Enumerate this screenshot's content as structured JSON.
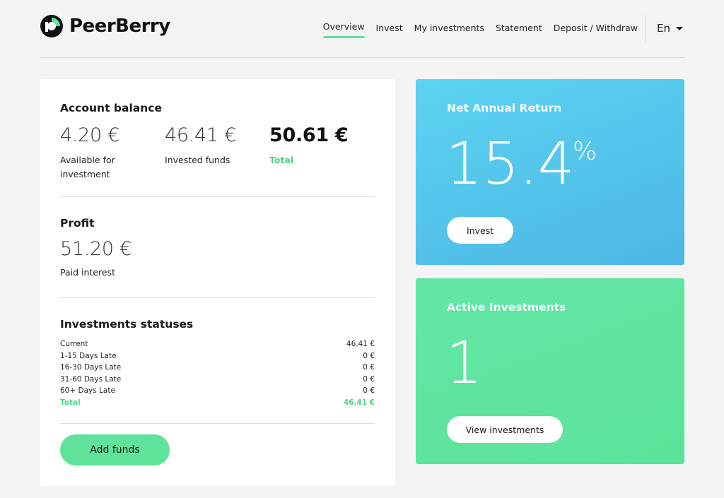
{
  "brand": {
    "name": "PeerBerry"
  },
  "nav": {
    "items": [
      {
        "label": "Overview",
        "active": true
      },
      {
        "label": "Invest",
        "active": false
      },
      {
        "label": "My investments",
        "active": false
      },
      {
        "label": "Statement",
        "active": false
      },
      {
        "label": "Deposit / Withdraw",
        "active": false
      }
    ],
    "language": "En"
  },
  "account_balance": {
    "title": "Account balance",
    "available_amount": "4.20 €",
    "available_label": "Available for investment",
    "invested_amount": "46.41 €",
    "invested_label": "Invested funds",
    "total_amount": "50.61 €",
    "total_label": "Total"
  },
  "profit": {
    "title": "Profit",
    "amount": "51.20 €",
    "label": "Paid interest"
  },
  "statuses": {
    "title": "Investments statuses",
    "rows": [
      {
        "label": "Current",
        "value": "46.41 €"
      },
      {
        "label": "1-15 Days Late",
        "value": "0 €"
      },
      {
        "label": "16-30 Days Late",
        "value": "0 €"
      },
      {
        "label": "31-60 Days Late",
        "value": "0 €"
      },
      {
        "label": "60+ Days Late",
        "value": "0 €"
      }
    ],
    "total_label": "Total",
    "total_value": "46.41 €"
  },
  "add_funds_label": "Add funds",
  "net_annual_return": {
    "title": "Net Annual Return",
    "value": "15.4",
    "unit": "%",
    "button": "Invest"
  },
  "active_investments": {
    "title": "Active Investments",
    "value": "1",
    "button": "View investments"
  },
  "colors": {
    "accent_green": "#5fe39b",
    "card_blue": "#4cb6e4",
    "card_green": "#5ce39a"
  }
}
